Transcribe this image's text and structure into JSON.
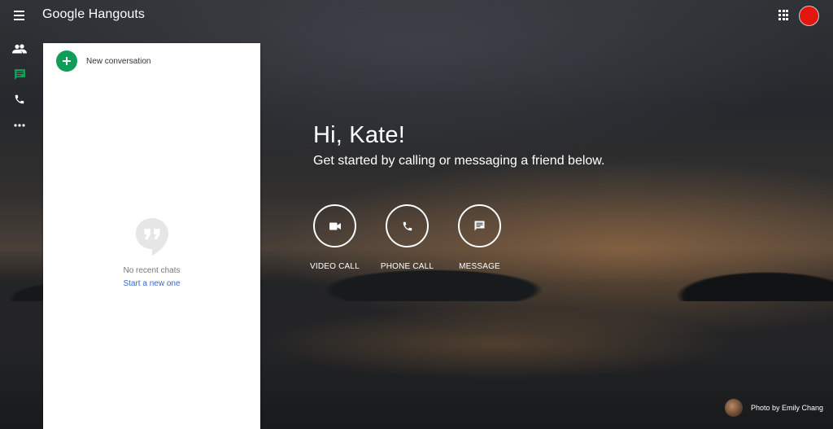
{
  "app": {
    "title": "Google Hangouts"
  },
  "header": {
    "menu_icon": "hamburger-menu-icon",
    "apps_icon": "apps-grid-icon",
    "avatar_color": "#e3160f"
  },
  "rail": {
    "items": [
      {
        "name": "contacts",
        "icon": "people-icon",
        "active": false
      },
      {
        "name": "conversations",
        "icon": "chat-icon",
        "active": true
      },
      {
        "name": "phone-calls",
        "icon": "phone-icon",
        "active": false
      },
      {
        "name": "more",
        "icon": "more-horiz-icon",
        "active": false
      }
    ],
    "active_color": "#0f9d58"
  },
  "panel": {
    "new_conversation_label": "New conversation",
    "empty_title": "No recent chats",
    "empty_link": "Start a new one"
  },
  "welcome": {
    "greeting": "Hi, Kate!",
    "subtitle": "Get started by calling or messaging a friend below."
  },
  "actions": [
    {
      "label": "VIDEO CALL",
      "icon": "videocam-icon"
    },
    {
      "label": "PHONE CALL",
      "icon": "phone-icon"
    },
    {
      "label": "MESSAGE",
      "icon": "message-icon"
    }
  ],
  "credit": {
    "text": "Photo by Emily Chang"
  },
  "colors": {
    "accent_green": "#0f9d58",
    "link_blue": "#3367d6"
  }
}
